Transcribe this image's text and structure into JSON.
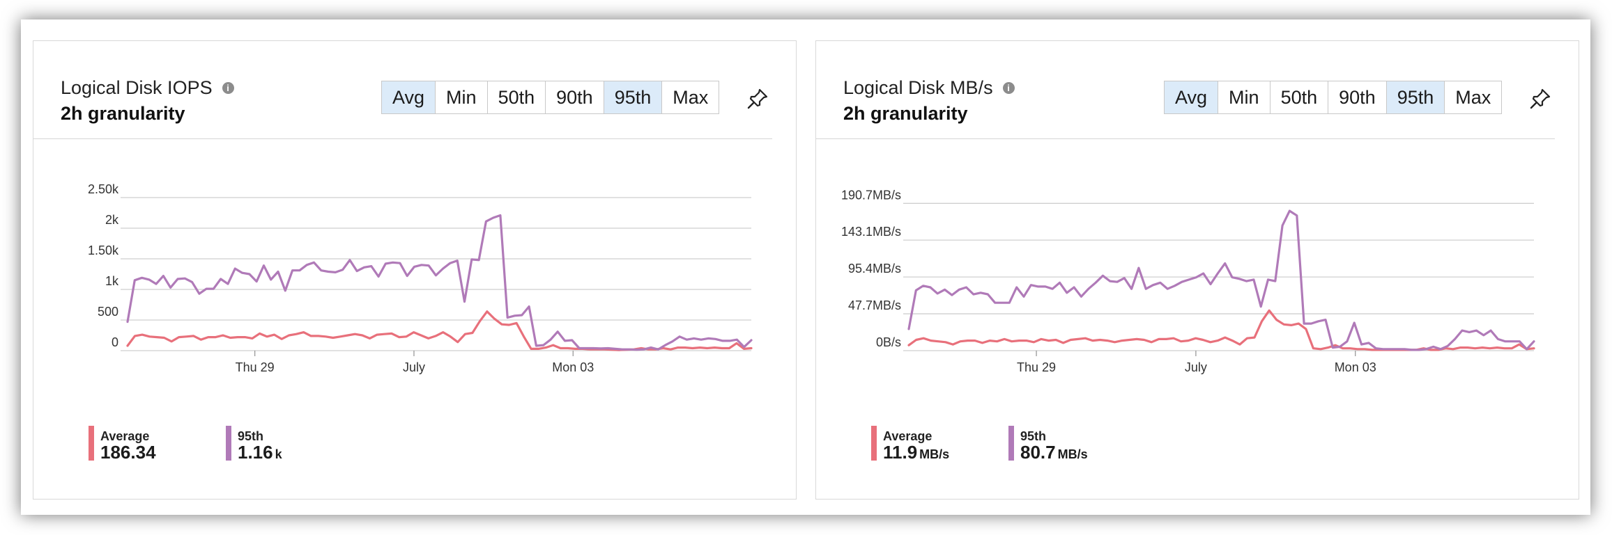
{
  "cards": [
    {
      "title": "Logical Disk IOPS",
      "subtitle": "2h granularity",
      "info_icon": "info-icon",
      "pin_icon": "pin-icon",
      "aggregations": [
        {
          "label": "Avg",
          "selected": true
        },
        {
          "label": "Min",
          "selected": false
        },
        {
          "label": "50th",
          "selected": false
        },
        {
          "label": "90th",
          "selected": false
        },
        {
          "label": "95th",
          "selected": true
        },
        {
          "label": "Max",
          "selected": false
        }
      ],
      "legend": [
        {
          "name": "Average",
          "value": "186.34",
          "unit": "",
          "color": "#e8707b"
        },
        {
          "name": "95th",
          "value": "1.16",
          "unit": "k",
          "color": "#b07ab8"
        }
      ]
    },
    {
      "title": "Logical Disk MB/s",
      "subtitle": "2h granularity",
      "info_icon": "info-icon",
      "pin_icon": "pin-icon",
      "aggregations": [
        {
          "label": "Avg",
          "selected": true
        },
        {
          "label": "Min",
          "selected": false
        },
        {
          "label": "50th",
          "selected": false
        },
        {
          "label": "90th",
          "selected": false
        },
        {
          "label": "95th",
          "selected": true
        },
        {
          "label": "Max",
          "selected": false
        }
      ],
      "legend": [
        {
          "name": "Average",
          "value": "11.9",
          "unit": "MB/s",
          "color": "#e8707b"
        },
        {
          "name": "95th",
          "value": "80.7",
          "unit": "MB/s",
          "color": "#b07ab8"
        }
      ]
    }
  ],
  "chart_data": [
    {
      "type": "line",
      "title": "Logical Disk IOPS",
      "ylim": [
        0,
        2500
      ],
      "yticks": [
        0,
        500,
        1000,
        1500,
        2000,
        2500
      ],
      "ytick_labels": [
        "0",
        "500",
        "1k",
        "1.50k",
        "2k",
        "2.50k"
      ],
      "xlim": [
        0,
        98
      ],
      "xticks": [
        {
          "x": 20,
          "label": "Thu 29"
        },
        {
          "x": 45,
          "label": "July"
        },
        {
          "x": 70,
          "label": "Mon 03"
        }
      ],
      "grid": true,
      "series": [
        {
          "name": "Average",
          "color": "#e8707b",
          "values": [
            80,
            240,
            260,
            230,
            220,
            210,
            150,
            220,
            230,
            240,
            180,
            220,
            220,
            250,
            210,
            220,
            220,
            200,
            280,
            230,
            260,
            190,
            250,
            270,
            300,
            240,
            240,
            230,
            210,
            230,
            250,
            270,
            250,
            200,
            260,
            270,
            280,
            220,
            230,
            300,
            250,
            200,
            240,
            300,
            230,
            140,
            270,
            290,
            480,
            640,
            520,
            430,
            420,
            450,
            230,
            30,
            30,
            50,
            90,
            40,
            40,
            30,
            30,
            20,
            20,
            20,
            15,
            10,
            15,
            20,
            40,
            20,
            20,
            40,
            20,
            50,
            50,
            40,
            50,
            40,
            50,
            40,
            40,
            120,
            30,
            40
          ]
        },
        {
          "name": "95th",
          "color": "#b07ab8",
          "values": [
            470,
            1150,
            1190,
            1160,
            1090,
            1220,
            1030,
            1170,
            1180,
            1120,
            930,
            1010,
            1010,
            1170,
            1090,
            1340,
            1270,
            1250,
            1130,
            1390,
            1160,
            1290,
            980,
            1310,
            1310,
            1400,
            1440,
            1310,
            1290,
            1280,
            1320,
            1480,
            1300,
            1360,
            1380,
            1210,
            1420,
            1440,
            1430,
            1220,
            1370,
            1400,
            1390,
            1230,
            1340,
            1430,
            1470,
            800,
            1490,
            1480,
            2110,
            2170,
            2210,
            540,
            570,
            580,
            720,
            80,
            90,
            180,
            310,
            160,
            170,
            40,
            40,
            40,
            35,
            40,
            30,
            20,
            20,
            15,
            20,
            50,
            20,
            90,
            150,
            230,
            180,
            200,
            180,
            200,
            190,
            160,
            160,
            180,
            60,
            170
          ]
        }
      ]
    },
    {
      "type": "line",
      "title": "Logical Disk MB/s",
      "ylim": [
        0,
        200
      ],
      "yticks": [
        0,
        47.7,
        95.4,
        143.1,
        190.7
      ],
      "ytick_labels": [
        "0B/s",
        "47.7MB/s",
        "95.4MB/s",
        "143.1MB/s",
        "190.7MB/s"
      ],
      "xlim": [
        0,
        98
      ],
      "xticks": [
        {
          "x": 20,
          "label": "Thu 29"
        },
        {
          "x": 45,
          "label": "July"
        },
        {
          "x": 70,
          "label": "Mon 03"
        }
      ],
      "grid": true,
      "series": [
        {
          "name": "Average",
          "color": "#e8707b",
          "values": [
            7,
            14,
            16,
            13,
            12,
            11,
            8,
            12,
            13,
            13,
            10,
            13,
            12,
            15,
            12,
            13,
            13,
            11,
            15,
            13,
            14,
            10,
            14,
            15,
            16,
            13,
            14,
            13,
            11,
            13,
            14,
            15,
            14,
            11,
            15,
            15,
            16,
            12,
            13,
            16,
            14,
            11,
            13,
            17,
            13,
            8,
            16,
            17,
            38,
            52,
            40,
            34,
            33,
            35,
            28,
            3,
            2,
            4,
            7,
            3,
            3,
            2,
            2,
            1,
            1,
            1,
            1,
            1,
            1,
            1,
            3,
            1,
            1,
            3,
            2,
            4,
            4,
            3,
            4,
            3,
            4,
            3,
            3,
            8,
            2,
            3
          ]
        },
        {
          "name": "95th",
          "color": "#b07ab8",
          "values": [
            28,
            78,
            84,
            82,
            74,
            79,
            72,
            79,
            82,
            73,
            75,
            73,
            62,
            62,
            62,
            82,
            70,
            85,
            83,
            83,
            80,
            88,
            75,
            82,
            70,
            80,
            88,
            97,
            90,
            89,
            94,
            80,
            107,
            80,
            85,
            88,
            80,
            84,
            89,
            92,
            95,
            100,
            86,
            100,
            113,
            95,
            93,
            90,
            92,
            57,
            92,
            90,
            162,
            181,
            175,
            35,
            35,
            38,
            40,
            4,
            5,
            12,
            36,
            8,
            10,
            3,
            2,
            2,
            2,
            2,
            1,
            1,
            2,
            5,
            2,
            6,
            15,
            26,
            24,
            26,
            20,
            26,
            15,
            12,
            12,
            12,
            2,
            12
          ]
        }
      ]
    }
  ]
}
